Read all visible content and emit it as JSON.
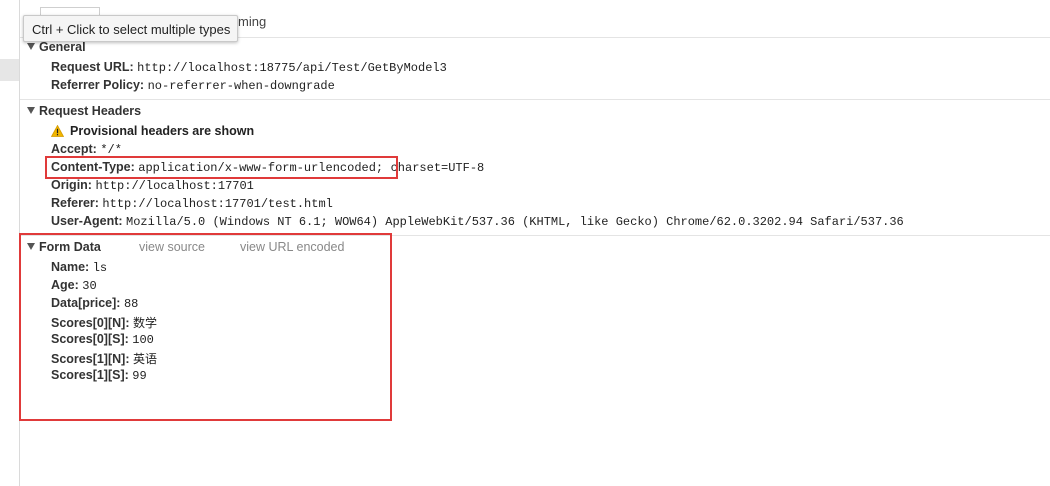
{
  "tooltip": "Ctrl + Click to select multiple types",
  "tabs": {
    "timing_fragment": "ming"
  },
  "general": {
    "title": "General",
    "request_url_label": "Request URL:",
    "request_url": "http://localhost:18775/api/Test/GetByModel3",
    "referrer_policy_label": "Referrer Policy:",
    "referrer_policy": "no-referrer-when-downgrade"
  },
  "request_headers": {
    "title": "Request Headers",
    "warning": "Provisional headers are shown",
    "accept_label": "Accept:",
    "accept": "*/*",
    "content_type_label": "Content-Type:",
    "content_type": "application/x-www-form-urlencoded;",
    "content_type_charset": "charset=UTF-8",
    "origin_label": "Origin:",
    "origin": "http://localhost:17701",
    "referer_label": "Referer:",
    "referer": "http://localhost:17701/test.html",
    "user_agent_label": "User-Agent:",
    "user_agent": "Mozilla/5.0 (Windows NT 6.1; WOW64) AppleWebKit/537.36 (KHTML, like Gecko) Chrome/62.0.3202.94 Safari/537.36"
  },
  "form_data": {
    "title": "Form Data",
    "view_source": "view source",
    "view_url_encoded": "view URL encoded",
    "fields": [
      {
        "key": "Name:",
        "value": "ls"
      },
      {
        "key": "Age:",
        "value": "30"
      },
      {
        "key": "Data[price]:",
        "value": "88"
      },
      {
        "key": "Scores[0][N]:",
        "value": "数学"
      },
      {
        "key": "Scores[0][S]:",
        "value": "100"
      },
      {
        "key": "Scores[1][N]:",
        "value": "英语"
      },
      {
        "key": "Scores[1][S]:",
        "value": "99"
      }
    ]
  },
  "colors": {
    "highlight": "#e03a3a",
    "warning": "#f2b600",
    "link": "#888888"
  }
}
